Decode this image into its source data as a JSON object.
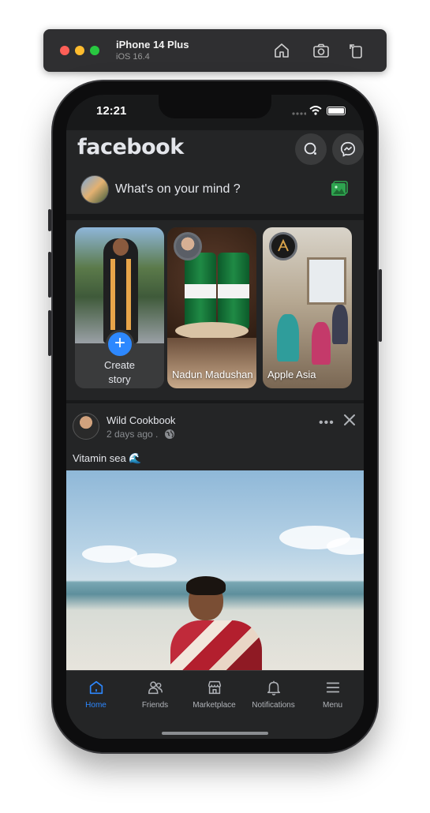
{
  "simulator": {
    "device_name": "iPhone 14 Plus",
    "os_version": "iOS 16.4",
    "icons": [
      "home-icon",
      "screenshot-icon",
      "rotate-icon"
    ]
  },
  "status_bar": {
    "time": "12:21"
  },
  "header": {
    "logo": "facebook",
    "icons": [
      "search-icon",
      "messenger-icon"
    ]
  },
  "composer": {
    "placeholder": "What's on your mind ?",
    "photo_icon_color": "#2ea44f"
  },
  "stories": {
    "create_label_line1": "Create",
    "create_label_line2": "story",
    "items": [
      {
        "name": "Nadun Madushan"
      },
      {
        "name": "Apple Asia",
        "badge": "APPLE ASIA"
      }
    ]
  },
  "post": {
    "author": "Wild Cookbook",
    "time": "2 days ago .",
    "text": "Vitamin sea 🌊",
    "more_label": "•••"
  },
  "tabbar": {
    "accent": "#2d88ff",
    "tabs": [
      {
        "label": "Home",
        "icon": "home-icon",
        "active": true
      },
      {
        "label": "Friends",
        "icon": "friends-icon"
      },
      {
        "label": "Marketplace",
        "icon": "marketplace-icon"
      },
      {
        "label": "Notifications",
        "icon": "bell-icon"
      },
      {
        "label": "Menu",
        "icon": "menu-icon"
      }
    ]
  }
}
